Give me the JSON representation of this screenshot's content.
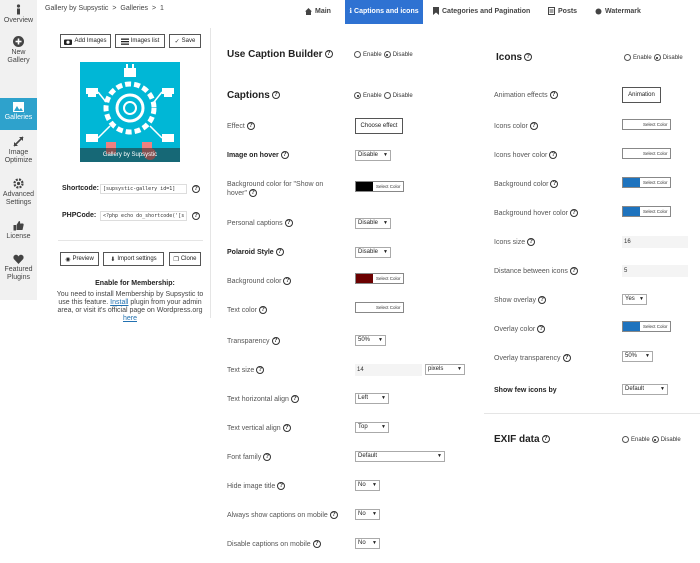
{
  "sidebar": {
    "items": [
      {
        "label": "Overview",
        "icon": "info-icon"
      },
      {
        "label": "New Gallery",
        "icon": "plus-icon"
      },
      {
        "label": "Galleries",
        "icon": "gallery-icon"
      },
      {
        "label": "Image Optimize",
        "icon": "compress-icon"
      },
      {
        "label": "Advanced Settings",
        "icon": "gears-icon"
      },
      {
        "label": "License",
        "icon": "thumbs-up-icon"
      },
      {
        "label": "Featured Plugins",
        "icon": "heart-icon"
      }
    ],
    "active_color": "#2ea2cc"
  },
  "breadcrumb": {
    "root": "Gallery by Supsystic",
    "sep": ">",
    "section": "Galleries",
    "current": "1"
  },
  "tabs": [
    {
      "label": "Main",
      "icon": "home-icon"
    },
    {
      "label": "Captions and icons",
      "icon": "info-icon"
    },
    {
      "label": "Categories and Pagination",
      "icon": "bookmark-icon"
    },
    {
      "label": "Posts",
      "icon": "document-icon"
    },
    {
      "label": "Watermark",
      "icon": "stamp-icon"
    }
  ],
  "left": {
    "add_images": "Add Images",
    "images_list": "Images list",
    "save": "Save",
    "thumb_caption": "Gallery by Supsystic",
    "shortcode_label": "Shortcode:",
    "shortcode_value": "[supsystic-gallery id=1]",
    "phpcode_label": "PHPCode:",
    "phpcode_value": "<?php echo do_shortcode('[s",
    "preview": "Preview",
    "import_settings": "Import settings",
    "clone": "Clone",
    "membership_title": "Enable for Membership:",
    "membership_pre": "You need to install Membership by Supsystic to use this feature.",
    "membership_link1": "Install",
    "membership_mid": "plugin from your admin area, or visit it's official page on Wordpress.org",
    "membership_link2": "here"
  },
  "captions": {
    "use_caption_builder": "Use Caption Builder",
    "captions_title": "Captions",
    "enable": "Enable",
    "disable": "Disable",
    "effect": "Effect",
    "choose_effect": "Choose effect",
    "image_on_hover": "Image on hover",
    "image_on_hover_val": "Disable",
    "bg_color_show_on_hover": "Background color for \"Show on hover\"",
    "select_color": "Select Color",
    "personal_captions": "Personal captions",
    "personal_captions_val": "Disable",
    "polaroid_style": "Polaroid Style",
    "polaroid_style_val": "Disable",
    "background_color": "Background color",
    "text_color": "Text color",
    "transparency": "Transparency",
    "transparency_val": "50%",
    "text_size": "Text size",
    "text_size_val": "14",
    "text_size_unit": "pixels",
    "text_h_align": "Text horizontal align",
    "text_h_align_val": "Left",
    "text_v_align": "Text vertical align",
    "text_v_align_val": "Top",
    "font_family": "Font family",
    "font_family_val": "Default",
    "hide_image_title": "Hide image title",
    "hide_image_title_val": "No",
    "always_show_mobile": "Always show captions on mobile",
    "always_show_mobile_val": "No",
    "disable_mobile": "Disable captions on mobile",
    "disable_mobile_val": "No",
    "colors": {
      "hover_bg": "#000000",
      "bg": "#6b0000",
      "text": "#ffffff"
    }
  },
  "icons": {
    "title": "Icons",
    "enable": "Enable",
    "disable": "Disable",
    "animation_effects": "Animation effects",
    "animation_btn": "Animation",
    "icons_color": "Icons color",
    "icons_hover_color": "Icons hover color",
    "background_color": "Background color",
    "background_hover_color": "Background hover color",
    "select_color": "Select Color",
    "icons_size": "Icons size",
    "icons_size_val": "16",
    "distance": "Distance between icons",
    "distance_val": "5",
    "show_overlay": "Show overlay",
    "show_overlay_val": "Yes",
    "overlay_color": "Overlay color",
    "overlay_transparency": "Overlay transparency",
    "overlay_transparency_val": "50%",
    "show_few_icons": "Show few icons by",
    "show_few_icons_val": "Default",
    "exif_title": "EXIF data",
    "colors": {
      "icons": "#ffffff",
      "icons_hover": "#ffffff",
      "bg": "#1e73be",
      "bg_hover": "#1e73be",
      "overlay": "#1e73be"
    }
  }
}
